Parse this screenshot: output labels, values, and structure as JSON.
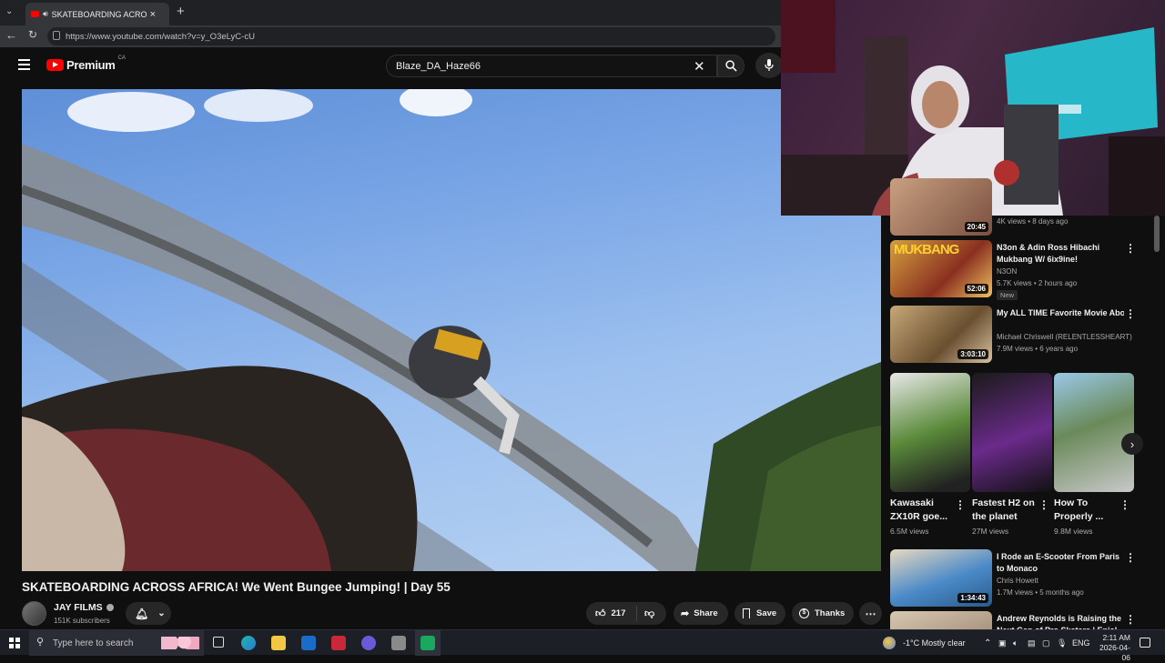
{
  "browser": {
    "tab_title": "SKATEBOARDING ACROSS AF",
    "url": "https://www.youtube.com/watch?v=y_O3eLyC-cU"
  },
  "youtube": {
    "logo_text": "Premium",
    "region": "CA",
    "search_value": "Blaze_DA_Haze66"
  },
  "video": {
    "title": "SKATEBOARDING ACROSS AFRICA! We Went Bungee Jumping! | Day 55",
    "channel": "JAY FILMS",
    "subscribers": "151K subscribers",
    "likes": "217",
    "share_label": "Share",
    "save_label": "Save",
    "thanks_label": "Thanks"
  },
  "sidebar": {
    "partial_top": {
      "duration": "20:45",
      "meta": "4K views • 8 days ago"
    },
    "items": [
      {
        "title": "N3on & Adin Ross Hibachi Mukbang W/ 6ix9ine!",
        "channel": "N3ON",
        "meta": "5.7K views • 2 hours ago",
        "badge": "New",
        "duration": "52:06"
      },
      {
        "title": "My ALL TIME Favorite Movie About Jesus Christ: The Gosp...",
        "channel": "Michael Chriswell (RELENTLESSHEART)",
        "meta": "7.9M views • 6 years ago",
        "duration": "3:03:10"
      },
      {
        "title": "I Rode an E-Scooter From Paris to Monaco",
        "channel": "Chris Howett",
        "meta": "1.7M views • 5 months ago",
        "duration": "1:34:43"
      },
      {
        "title": "Andrew Reynolds is Raising the Next Gen of Pro Skaters | Epic!",
        "channel": "",
        "meta": "",
        "duration": ""
      }
    ],
    "shorts": [
      {
        "title": "Kawasaki ZX10R goe...",
        "views": "6.5M views"
      },
      {
        "title": "Fastest H2 on the planet",
        "views": "27M views"
      },
      {
        "title": "How To Properly ...",
        "views": "9.8M views"
      }
    ]
  },
  "taskbar": {
    "search_placeholder": "Type here to search",
    "weather": "-1°C  Mostly clear",
    "language": "ENG",
    "time": "2:11 AM",
    "date": "2026-04-06"
  },
  "colors": {
    "youtube_red": "#ff0000",
    "background": "#0f0f0f",
    "text_secondary": "#aaaaaa"
  }
}
